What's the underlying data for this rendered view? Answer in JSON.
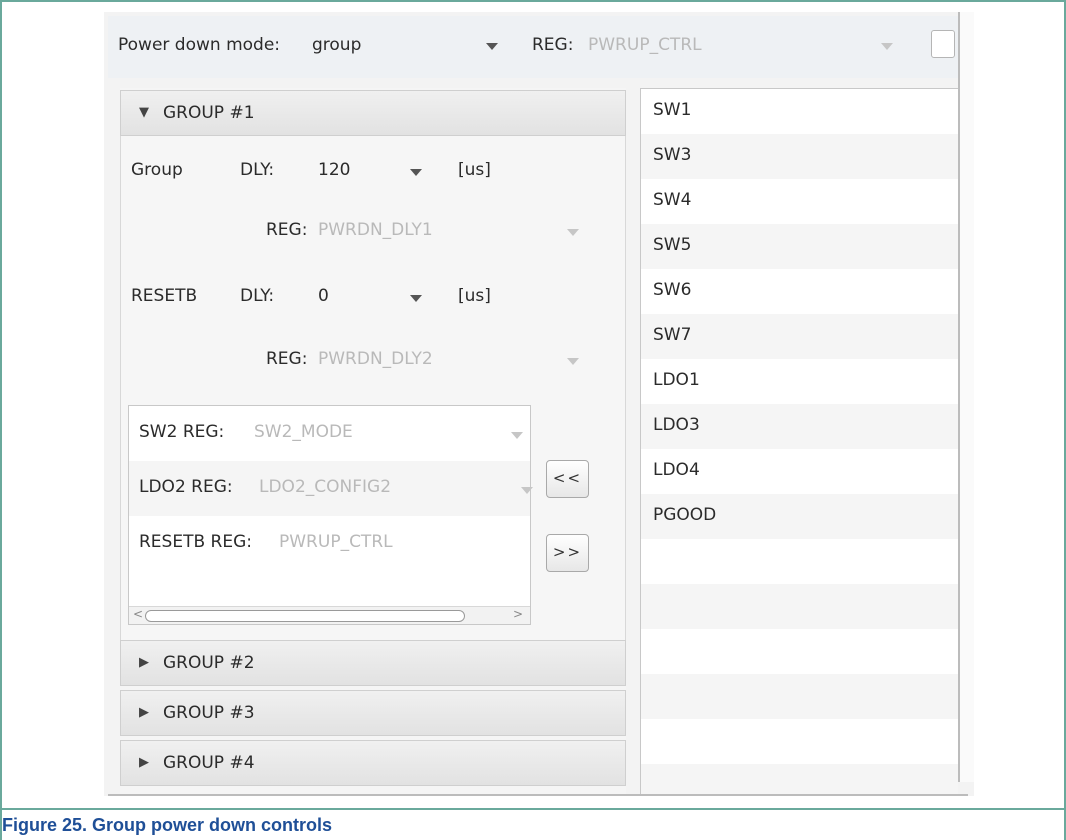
{
  "toolbar": {
    "mode_label": "Power down mode:",
    "mode_value": "group",
    "reg_label": "REG:",
    "reg_value": "PWRUP_CTRL"
  },
  "group1": {
    "header": "GROUP #1",
    "group_label": "Group",
    "group_dly_label": "DLY:",
    "group_dly_value": "120",
    "group_dly_unit": "[us]",
    "group_reg_label": "REG:",
    "group_reg_value": "PWRDN_DLY1",
    "resetb_label": "RESETB",
    "resetb_dly_label": "DLY:",
    "resetb_dly_value": "0",
    "resetb_dly_unit": "[us]",
    "resetb_reg_label": "REG:",
    "resetb_reg_value": "PWRDN_DLY2",
    "members": [
      {
        "label": "SW2 REG:",
        "value": "SW2_MODE"
      },
      {
        "label": "LDO2 REG:",
        "value": "LDO2_CONFIG2"
      },
      {
        "label": "RESETB REG:",
        "value": "PWRUP_CTRL"
      }
    ]
  },
  "buttons": {
    "move_left": "<<",
    "move_right": ">>"
  },
  "groups_collapsed": [
    "GROUP #2",
    "GROUP #3",
    "GROUP #4"
  ],
  "available": [
    "SW1",
    "SW3",
    "SW4",
    "SW5",
    "SW6",
    "SW7",
    "LDO1",
    "LDO3",
    "LDO4",
    "PGOOD"
  ],
  "caption": "Figure 25.  Group power down controls"
}
